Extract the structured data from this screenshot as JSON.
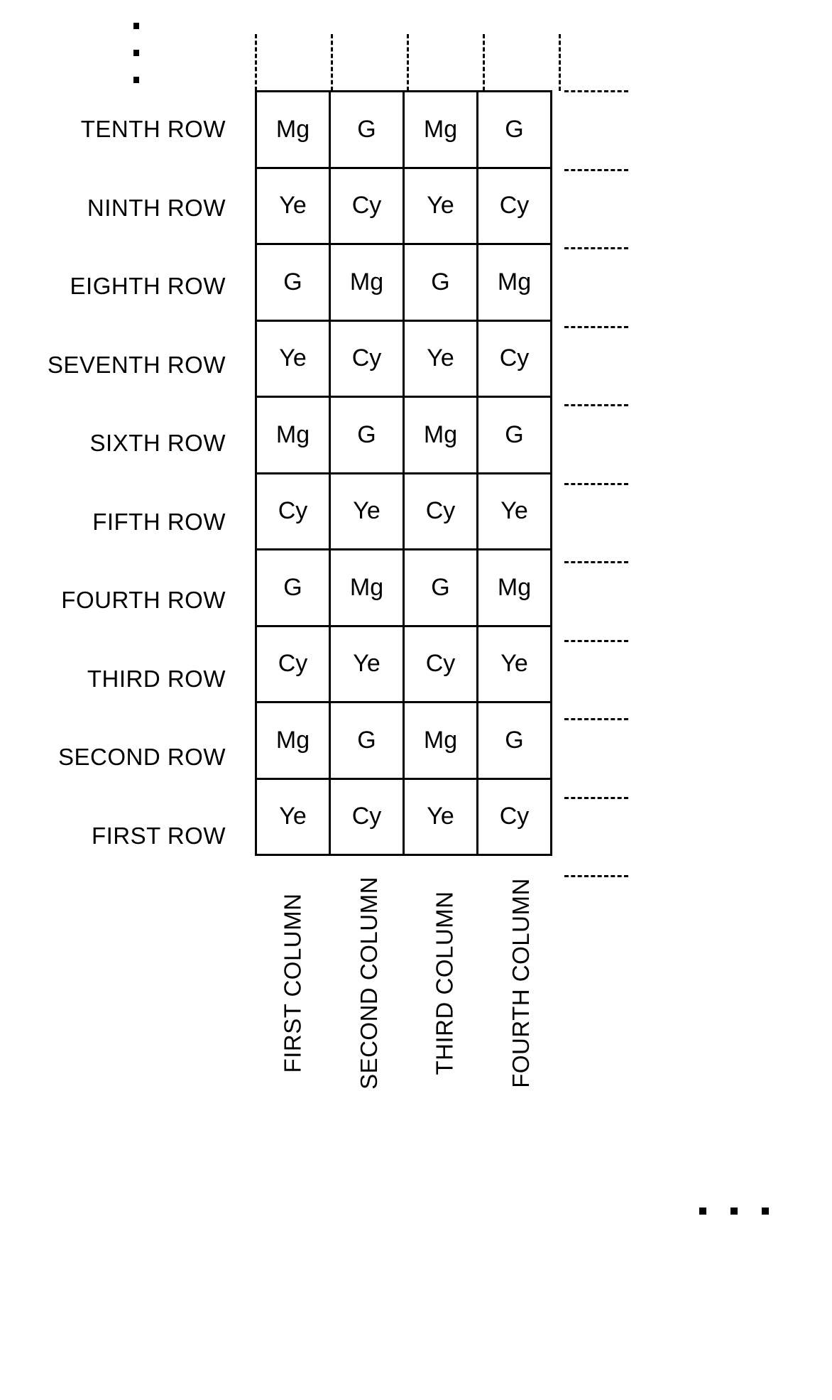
{
  "figure": {
    "type": "color-filter-array-pattern-table",
    "row_labels": [
      "TENTH ROW",
      "NINTH ROW",
      "EIGHTH ROW",
      "SEVENTH ROW",
      "SIXTH ROW",
      "FIFTH ROW",
      "FOURTH ROW",
      "THIRD ROW",
      "SECOND ROW",
      "FIRST ROW"
    ],
    "column_labels": [
      "FIRST COLUMN",
      "SECOND COLUMN",
      "THIRD COLUMN",
      "FOURTH COLUMN"
    ],
    "cells": [
      [
        "Mg",
        "G",
        "Mg",
        "G"
      ],
      [
        "Ye",
        "Cy",
        "Ye",
        "Cy"
      ],
      [
        "G",
        "Mg",
        "G",
        "Mg"
      ],
      [
        "Ye",
        "Cy",
        "Ye",
        "Cy"
      ],
      [
        "Mg",
        "G",
        "Mg",
        "G"
      ],
      [
        "Cy",
        "Ye",
        "Cy",
        "Ye"
      ],
      [
        "G",
        "Mg",
        "G",
        "Mg"
      ],
      [
        "Cy",
        "Ye",
        "Cy",
        "Ye"
      ],
      [
        "Mg",
        "G",
        "Mg",
        "G"
      ],
      [
        "Ye",
        "Cy",
        "Ye",
        "Cy"
      ]
    ],
    "continuation_marks": {
      "vertical_ellipsis": "⋮",
      "horizontal_ellipsis": "· · ·"
    },
    "colors": {
      "line": "#000000",
      "background": "#ffffff"
    }
  },
  "chart_data": {
    "type": "table",
    "title": "",
    "row_headers": [
      "TENTH ROW",
      "NINTH ROW",
      "EIGHTH ROW",
      "SEVENTH ROW",
      "SIXTH ROW",
      "FIFTH ROW",
      "FOURTH ROW",
      "THIRD ROW",
      "SECOND ROW",
      "FIRST ROW"
    ],
    "column_headers": [
      "FIRST COLUMN",
      "SECOND COLUMN",
      "THIRD COLUMN",
      "FOURTH COLUMN"
    ],
    "values": [
      [
        "Mg",
        "G",
        "Mg",
        "G"
      ],
      [
        "Ye",
        "Cy",
        "Ye",
        "Cy"
      ],
      [
        "G",
        "Mg",
        "G",
        "Mg"
      ],
      [
        "Ye",
        "Cy",
        "Ye",
        "Cy"
      ],
      [
        "Mg",
        "G",
        "Mg",
        "G"
      ],
      [
        "Cy",
        "Ye",
        "Cy",
        "Ye"
      ],
      [
        "G",
        "Mg",
        "G",
        "Mg"
      ],
      [
        "Cy",
        "Ye",
        "Cy",
        "Ye"
      ],
      [
        "Mg",
        "G",
        "Mg",
        "G"
      ],
      [
        "Ye",
        "Cy",
        "Ye",
        "Cy"
      ]
    ]
  }
}
